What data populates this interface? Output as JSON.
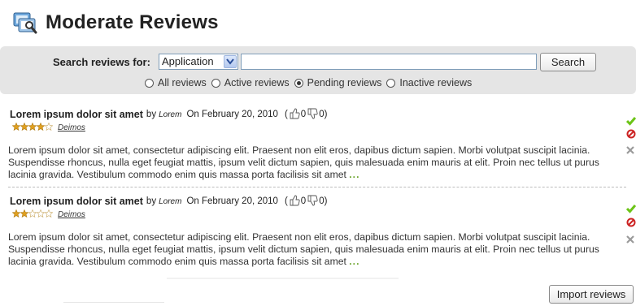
{
  "page": {
    "title": "Moderate Reviews"
  },
  "search": {
    "label": "Search reviews for:",
    "scope_selected": "Application",
    "query_value": "",
    "button_label": "Search",
    "filters": [
      {
        "label": "All reviews",
        "checked": false
      },
      {
        "label": "Active reviews",
        "checked": false
      },
      {
        "label": "Pending reviews",
        "checked": true
      },
      {
        "label": "Inactive reviews",
        "checked": false
      }
    ]
  },
  "reviews": [
    {
      "title": "Lorem ipsum dolor sit amet",
      "by": "by",
      "author": "Lorem",
      "date": "On February 20, 2010",
      "votes_open": "(",
      "upvotes": "0",
      "downvotes": "0",
      "votes_close": ")",
      "rating": 4,
      "max_rating": 5,
      "reviewer": "Deimos",
      "body": "Lorem ipsum dolor sit amet, consectetur adipiscing elit. Praesent non elit eros, dapibus dictum sapien. Morbi volutpat suscipit lacinia. Suspendisse rhoncus, nulla eget feugiat mattis, ipsum velit dictum sapien, quis malesuada enim mauris at elit. Proin nec tellus ut purus lacinia gravida. Vestibulum commodo enim quis massa porta facilisis sit amet",
      "more": "..."
    },
    {
      "title": "Lorem ipsum dolor sit amet",
      "by": "by",
      "author": "Lorem",
      "date": "On February 20, 2010",
      "votes_open": "(",
      "upvotes": "0",
      "downvotes": "0",
      "votes_close": ")",
      "rating": 2,
      "max_rating": 5,
      "reviewer": "Deimos",
      "body": "Lorem ipsum dolor sit amet, consectetur adipiscing elit. Praesent non elit eros, dapibus dictum sapien. Morbi volutpat suscipit lacinia. Suspendisse rhoncus, nulla eget feugiat mattis, ipsum velit dictum sapien, quis malesuada enim mauris at elit. Proin nec tellus ut purus lacinia gravida. Vestibulum commodo enim quis massa porta facilisis sit amet",
      "more": "..."
    }
  ],
  "actions": {
    "import_label": "Import reviews"
  },
  "colors": {
    "panel_bg": "#e5e5e5",
    "star_filled": "#e0a020",
    "approve": "#6cc417",
    "reject": "#cc2222",
    "delete": "#9a9a9a",
    "ellipsis": "#6aa32a"
  },
  "icons": {
    "title": "moderate-reviews-icon",
    "thumbs_up": "thumbs-up-icon",
    "thumbs_down": "thumbs-down-icon",
    "approve": "check-icon",
    "reject": "block-icon",
    "delete": "x-icon"
  }
}
